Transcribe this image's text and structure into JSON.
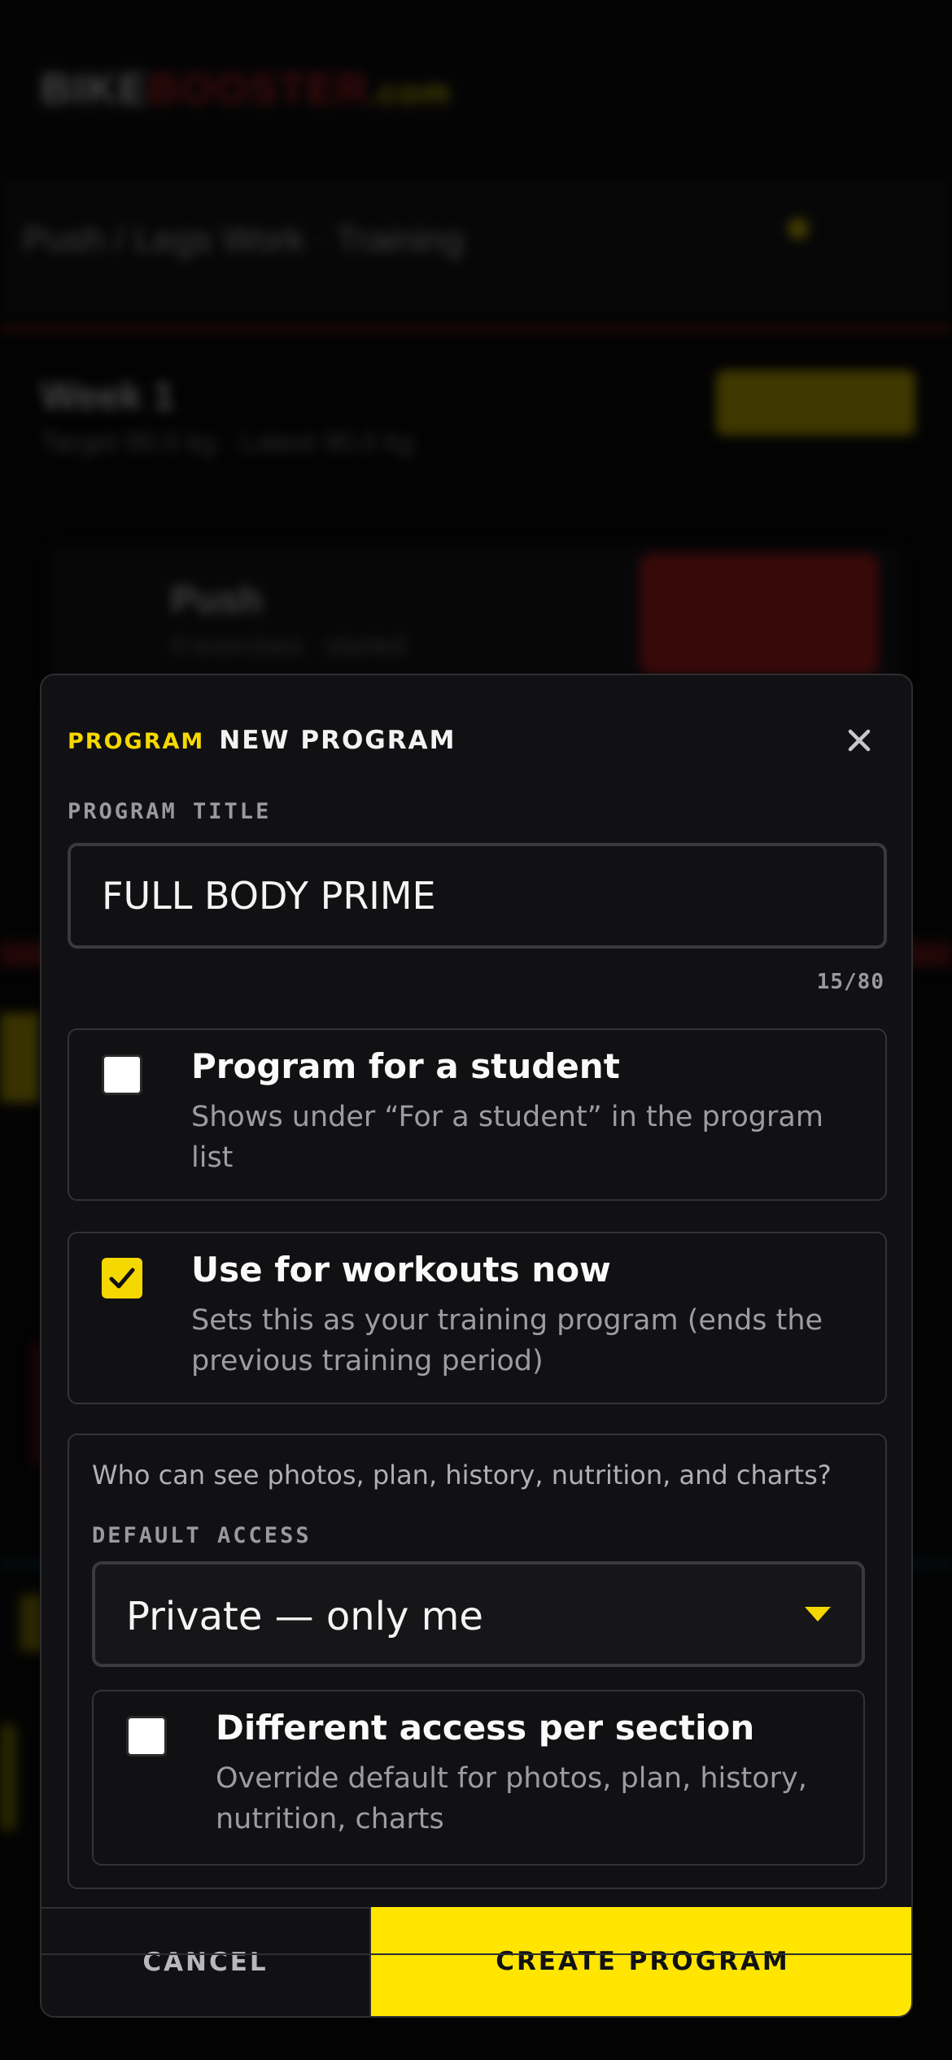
{
  "background": {
    "logo_white": "BIKE",
    "logo_red": "BOOSTER",
    "logo_yellow": ".com",
    "tab_title": "Push / Legs Work · Training",
    "week_title": "Week 1",
    "week_sub": "Target  90.0 kg    ·    Latest  90.0 kg",
    "session_title": "Push",
    "session_sub": "4 exercises  ·  started"
  },
  "modal": {
    "eyebrow": "PROGRAM",
    "title": "NEW PROGRAM",
    "close_icon": "close-icon",
    "program_title_label": "PROGRAM TITLE",
    "program_title_value": "FULL BODY PRIME",
    "char_counter": "15/80",
    "options": {
      "student": {
        "title": "Program for a student",
        "description": "Shows under “For a student” in the program list",
        "checked": false
      },
      "use_now": {
        "title": "Use for workouts now",
        "description": "Sets this as your training program (ends the previous training period)",
        "checked": true
      }
    },
    "access": {
      "question": "Who can see photos, plan, history, nutrition, and charts?",
      "default_label": "DEFAULT ACCESS",
      "selected": "Private — only me",
      "per_section": {
        "title": "Different access per section",
        "description": "Override default for photos, plan, history, nutrition, charts",
        "checked": false
      }
    },
    "footer": {
      "cancel": "CANCEL",
      "create": "CREATE PROGRAM"
    }
  },
  "colors": {
    "accent_yellow": "#f5d800",
    "button_yellow": "#ffe500",
    "surface": "#111113",
    "border": "#333336"
  }
}
